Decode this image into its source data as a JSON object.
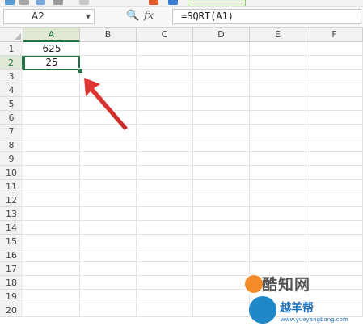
{
  "formula_bar": {
    "name_box": "A2",
    "fx_label": "fx",
    "formula": "=SQRT(A1)"
  },
  "columns": [
    "A",
    "B",
    "C",
    "D",
    "E",
    "F"
  ],
  "rows": [
    "1",
    "2",
    "3",
    "4",
    "5",
    "6",
    "7",
    "8",
    "9",
    "10",
    "11",
    "12",
    "13",
    "14",
    "15",
    "16",
    "17",
    "18",
    "19",
    "20"
  ],
  "cells": {
    "A1": "625",
    "A2": "25"
  },
  "watermark": {
    "brand": "酷知网",
    "brand2": "越羊帮",
    "url": "www.yueyangbang.com"
  },
  "colors": {
    "selection": "#217346",
    "arrow": "#e03b3b"
  }
}
